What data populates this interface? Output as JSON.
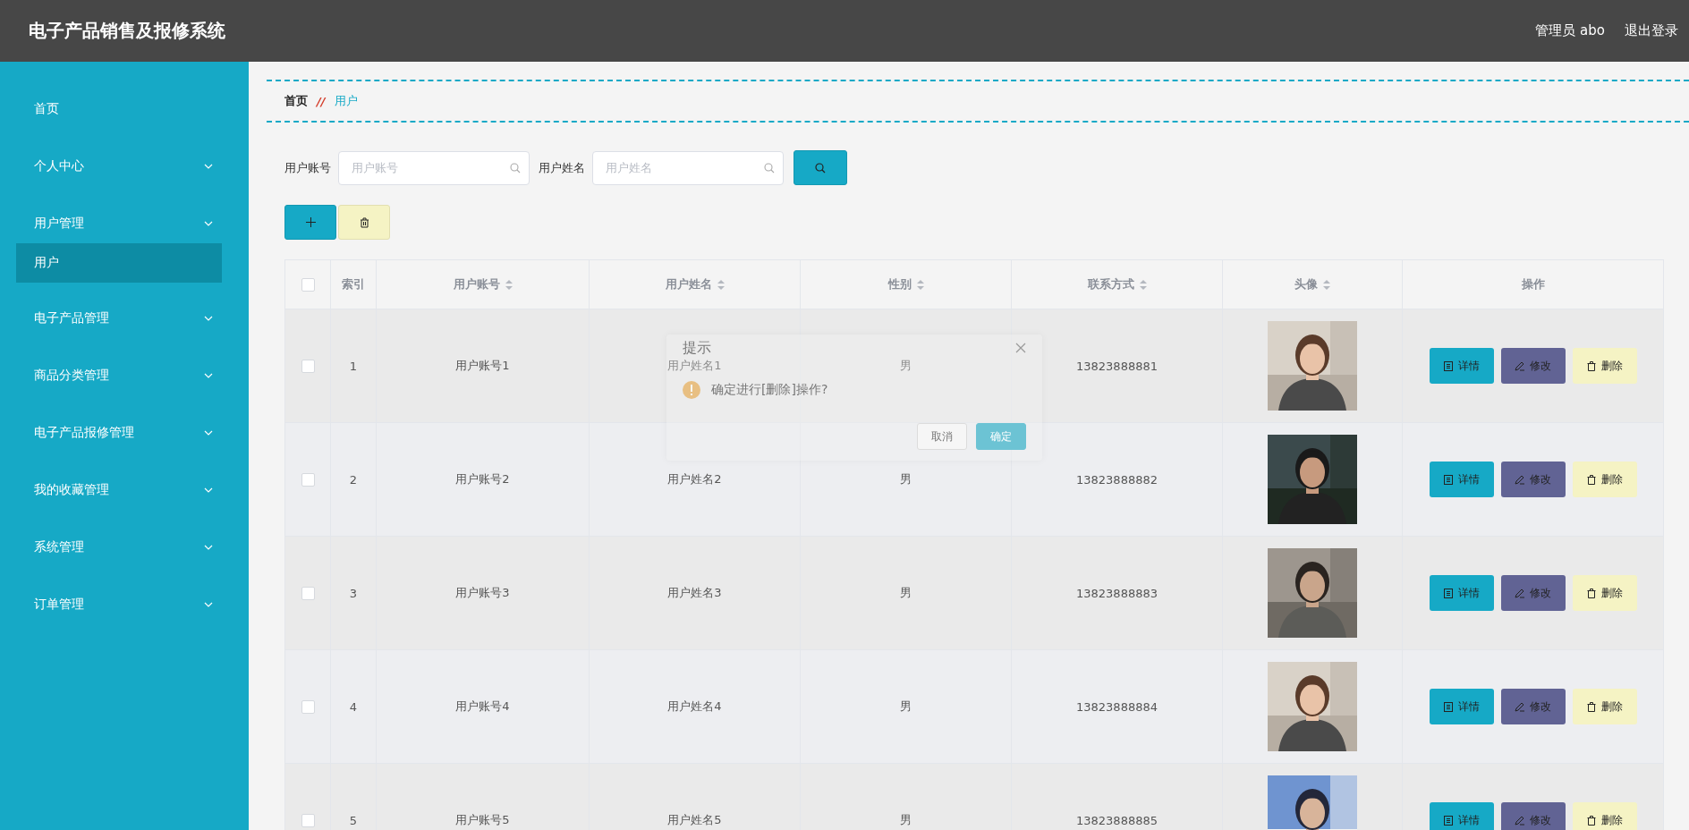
{
  "header": {
    "title": "电子产品销售及报修系统",
    "user_label": "管理员 abo",
    "logout": "退出登录"
  },
  "sidebar": {
    "items": [
      {
        "label": "首页",
        "kind": "link",
        "selected": false
      },
      {
        "label": "个人中心",
        "kind": "submenu",
        "selected": false
      },
      {
        "label": "用户管理",
        "kind": "submenu",
        "selected": false,
        "children": [
          {
            "label": "用户",
            "selected": true
          }
        ]
      },
      {
        "label": "电子产品管理",
        "kind": "submenu",
        "selected": false
      },
      {
        "label": "商品分类管理",
        "kind": "submenu",
        "selected": false
      },
      {
        "label": "电子产品报修管理",
        "kind": "submenu",
        "selected": false
      },
      {
        "label": "我的收藏管理",
        "kind": "submenu",
        "selected": false
      },
      {
        "label": "系统管理",
        "kind": "submenu",
        "selected": false
      },
      {
        "label": "订单管理",
        "kind": "submenu",
        "selected": false
      }
    ]
  },
  "breadcrumb": {
    "items": [
      "首页",
      "用户"
    ],
    "separator": "//"
  },
  "search": {
    "fields": [
      {
        "label": "用户账号",
        "placeholder": "用户账号"
      },
      {
        "label": "用户姓名",
        "placeholder": "用户姓名"
      }
    ]
  },
  "table": {
    "select_all_checked": false,
    "columns": [
      {
        "label": "索引",
        "sortable": false
      },
      {
        "label": "用户账号",
        "sortable": true
      },
      {
        "label": "用户姓名",
        "sortable": true
      },
      {
        "label": "性别",
        "sortable": true
      },
      {
        "label": "联系方式",
        "sortable": true
      },
      {
        "label": "头像",
        "sortable": true
      },
      {
        "label": "操作",
        "sortable": false
      }
    ],
    "rows": [
      {
        "checked": false,
        "index": "1",
        "account": "用户账号1",
        "name": "用户姓名1",
        "gender": "男",
        "phone": "13823888881",
        "actions": [
          {
            "kind": "detail",
            "label": "详情"
          },
          {
            "kind": "edit",
            "label": "修改"
          },
          {
            "kind": "delete",
            "label": "删除"
          }
        ]
      },
      {
        "checked": false,
        "index": "2",
        "account": "用户账号2",
        "name": "用户姓名2",
        "gender": "男",
        "phone": "13823888882",
        "actions": [
          {
            "kind": "detail",
            "label": "详情"
          },
          {
            "kind": "edit",
            "label": "修改"
          },
          {
            "kind": "delete",
            "label": "删除"
          }
        ]
      },
      {
        "checked": false,
        "index": "3",
        "account": "用户账号3",
        "name": "用户姓名3",
        "gender": "男",
        "phone": "13823888883",
        "actions": [
          {
            "kind": "detail",
            "label": "详情"
          },
          {
            "kind": "edit",
            "label": "修改"
          },
          {
            "kind": "delete",
            "label": "删除"
          }
        ]
      },
      {
        "checked": false,
        "index": "4",
        "account": "用户账号4",
        "name": "用户姓名4",
        "gender": "男",
        "phone": "13823888884",
        "actions": [
          {
            "kind": "detail",
            "label": "详情"
          },
          {
            "kind": "edit",
            "label": "修改"
          },
          {
            "kind": "delete",
            "label": "删除"
          }
        ]
      },
      {
        "checked": false,
        "index": "5",
        "account": "用户账号5",
        "name": "用户姓名5",
        "gender": "男",
        "phone": "13823888885",
        "actions": [
          {
            "kind": "detail",
            "label": "详情"
          },
          {
            "kind": "edit",
            "label": "修改"
          },
          {
            "kind": "delete",
            "label": "删除"
          }
        ]
      }
    ]
  },
  "dialog": {
    "title": "提示",
    "message": "确定进行[删除]操作?",
    "buttons": [
      {
        "kind": "cancel",
        "label": "取消"
      },
      {
        "kind": "confirm",
        "label": "确定"
      }
    ]
  }
}
